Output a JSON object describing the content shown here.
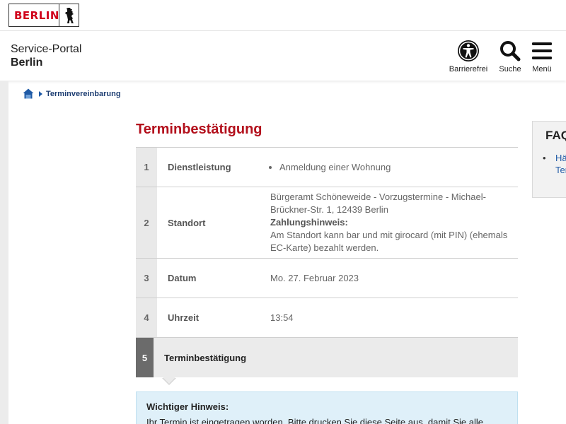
{
  "logo": {
    "text": "BERLIN",
    "icon": "berlin-bear-icon"
  },
  "header": {
    "portal_line1": "Service-Portal",
    "portal_line2": "Berlin",
    "accessibility_label": "Barrierefrei",
    "search_label": "Suche",
    "menu_label": "Menü"
  },
  "breadcrumb": {
    "home_icon": "home-icon",
    "current": "Terminvereinbarung"
  },
  "page_title": "Terminbestätigung",
  "steps": [
    {
      "num": "1",
      "label": "Dienstleistung",
      "value": "Anmeldung einer Wohnung"
    },
    {
      "num": "2",
      "label": "Standort",
      "value_line": "Bürgeramt Schöneweide - Vorzugstermine - Michael-Brückner-Str. 1, 12439 Berlin",
      "payment_title": "Zahlungshinweis:",
      "payment_text": "Am Standort kann bar und mit girocard (mit PIN) (ehemals EC-Karte) bezahlt werden."
    },
    {
      "num": "3",
      "label": "Datum",
      "value": "Mo. 27. Februar 2023"
    },
    {
      "num": "4",
      "label": "Uhrzeit",
      "value": "13:54"
    },
    {
      "num": "5",
      "label": "Terminbestätigung"
    }
  ],
  "notice": {
    "title": "Wichtiger Hinweis:",
    "text": "Ihr Termin ist eingetragen worden. Bitte drucken Sie diese Seite aus, damit Sie alle"
  },
  "faq": {
    "title": "FAQ",
    "link_line1": "Hä",
    "link_line2": "Ter"
  },
  "colors": {
    "brand_red": "#d0021b",
    "title_red": "#b3101c",
    "link_blue": "#1f5aa6",
    "notice_bg": "#dff0f9"
  }
}
